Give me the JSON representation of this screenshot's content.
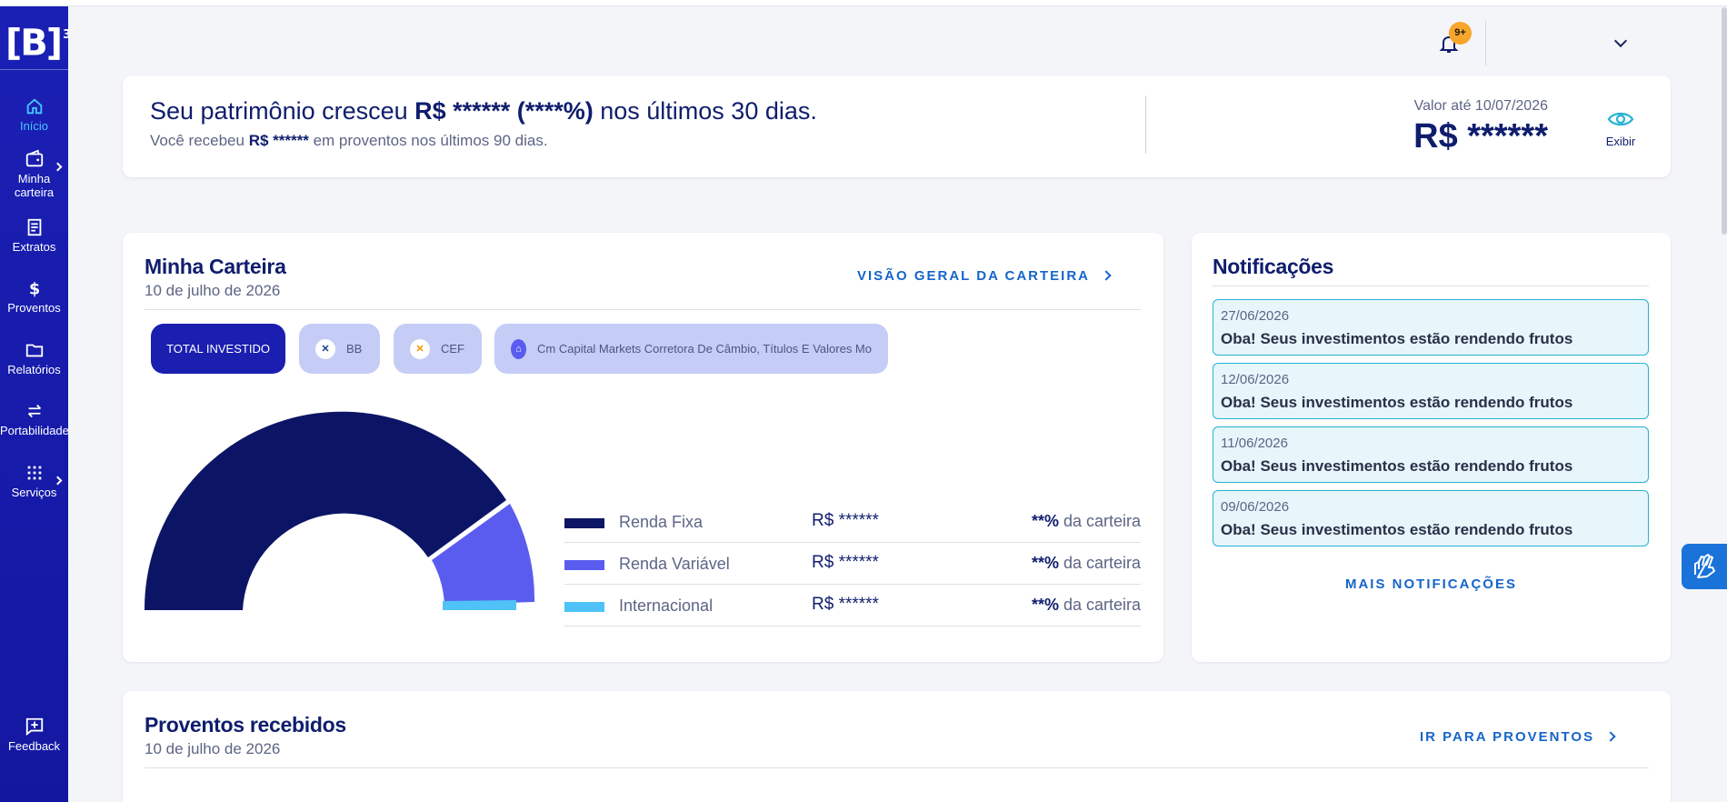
{
  "sidebar": {
    "logo": "[B]",
    "logo_sup": "3",
    "items": [
      {
        "label": "Início",
        "icon": "home-icon"
      },
      {
        "label": "Minha carteira",
        "icon": "wallet-icon"
      },
      {
        "label": "Extratos",
        "icon": "receipt-icon"
      },
      {
        "label": "Proventos",
        "icon": "dollar-icon"
      },
      {
        "label": "Relatórios",
        "icon": "folder-icon"
      },
      {
        "label": "Portabilidade",
        "icon": "transfer-icon"
      },
      {
        "label": "Serviços",
        "icon": "grid-icon"
      }
    ],
    "feedback": {
      "label": "Feedback",
      "icon": "feedback-icon"
    }
  },
  "topbar": {
    "notif_badge": "9+"
  },
  "banner": {
    "title_prefix": "Seu patrimônio cresceu ",
    "title_amount": "R$ ****** (****%)",
    "title_suffix": " nos últimos 30 dias.",
    "sub_prefix": "Você recebeu ",
    "sub_amount": "R$ ******",
    "sub_suffix": " em proventos nos últimos 90 dias.",
    "value_label": "Valor até 10/07/2026",
    "value_amount": "R$ ******",
    "show_label": "Exibir"
  },
  "carteira": {
    "title": "Minha Carteira",
    "date": "10 de julho de 2026",
    "link": "VISÃO GERAL DA CARTEIRA",
    "chips": [
      {
        "label": "TOTAL INVESTIDO"
      },
      {
        "label": "BB"
      },
      {
        "label": "CEF"
      },
      {
        "label": "Cm Capital Markets Corretora De Câmbio, Títulos E Valores Mo"
      }
    ],
    "legend": [
      {
        "name": "Renda Fixa",
        "value": "R$ ******",
        "pct_strong": "**%",
        "pct_text": " da carteira",
        "color": "#0c1565"
      },
      {
        "name": "Renda Variável",
        "value": "R$ ******",
        "pct_strong": "**%",
        "pct_text": " da carteira",
        "color": "#5a5cf0"
      },
      {
        "name": "Internacional",
        "value": "R$ ******",
        "pct_strong": "**%",
        "pct_text": " da carteira",
        "color": "#4fc3f7"
      }
    ]
  },
  "notificacoes": {
    "title": "Notificações",
    "items": [
      {
        "date": "27/06/2026",
        "text": "Oba! Seus investimentos estão rendendo frutos"
      },
      {
        "date": "12/06/2026",
        "text": "Oba! Seus investimentos estão rendendo frutos"
      },
      {
        "date": "11/06/2026",
        "text": "Oba! Seus investimentos estão rendendo frutos"
      },
      {
        "date": "09/06/2026",
        "text": "Oba! Seus investimentos estão rendendo frutos"
      }
    ],
    "more": "MAIS NOTIFICAÇÕES"
  },
  "proventos": {
    "title": "Proventos recebidos",
    "date": "10 de julho de 2026",
    "link": "IR PARA PROVENTOS"
  }
}
